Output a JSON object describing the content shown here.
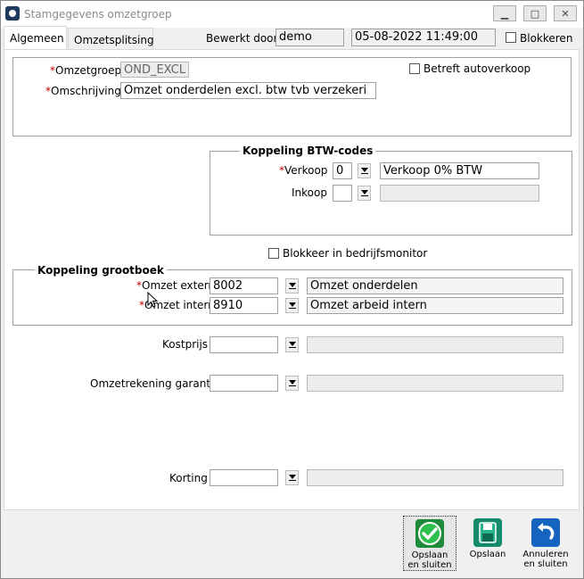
{
  "window": {
    "title": "Stamgegevens omzetgroep",
    "minimize_label": "▭",
    "maximize_label": "⧉",
    "close_label": "✕"
  },
  "tabs": [
    {
      "label": "Algemeen",
      "active": true
    },
    {
      "label": "Omzetsplitsing",
      "active": false
    }
  ],
  "header": {
    "edited_by_label": "Bewerkt door",
    "edited_by_value": "demo",
    "timestamp": "05-08-2022 11:49:00",
    "block_label": "Blokkeren",
    "block_checked": false
  },
  "general": {
    "required_mark": "*",
    "group_label": "Omzetgroep",
    "group_value": "OND_EXCL",
    "description_label": "Omschrijving",
    "description_value": "Omzet onderdelen excl. btw tvb verzekeri",
    "auto_sale_label": "Betreft autoverkoop",
    "auto_sale_checked": false
  },
  "vat": {
    "title": "Koppeling BTW-codes",
    "sales_label": "Verkoop",
    "sales_code": "0",
    "sales_desc": "Verkoop 0% BTW",
    "purchase_label": "Inkoop",
    "purchase_code": "",
    "purchase_desc": ""
  },
  "monitor": {
    "block_label": "Blokkeer in bedrijfsmonitor",
    "checked": false
  },
  "ledger": {
    "title": "Koppeling grootboek",
    "external_label": "Omzet extern",
    "external_code": "8002",
    "external_desc": "Omzet onderdelen",
    "internal_label": "Omzet intern",
    "internal_code": "8910",
    "internal_desc": "Omzet arbeid intern"
  },
  "extra": {
    "cost_label": "Kostprijs",
    "cost_code": "",
    "cost_desc": "",
    "warranty_label": "Omzetrekening garantie",
    "warranty_code": "",
    "warranty_desc": "",
    "discount_label": "Korting",
    "discount_code": "",
    "discount_desc": ""
  },
  "footer": {
    "save_close_label": "Opslaan en sluiten",
    "save_label": "Opslaan",
    "cancel_close_label": "Annuleren en sluiten"
  },
  "colors": {
    "required": "#c00000",
    "save_close_icon": "#1f8a3a",
    "save_icon": "#138a6a",
    "cancel_icon": "#1565c0"
  }
}
